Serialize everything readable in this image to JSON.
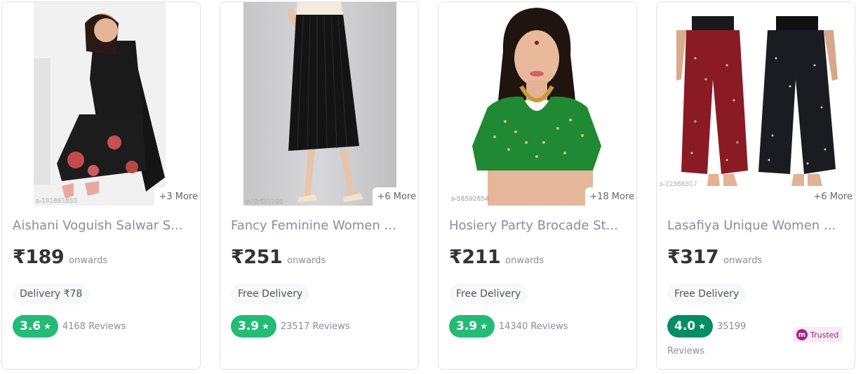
{
  "products": [
    {
      "title": "Aishani Voguish Salwar S...",
      "price": "₹189",
      "onwards": "onwards",
      "delivery": "Delivery ₹78",
      "rating": "3.6",
      "rating_color": "#23bb75",
      "reviews": "4168 Reviews",
      "more": "+3 More",
      "watermark": "s-101891653"
    },
    {
      "title": "Fancy Feminine Women ...",
      "price": "₹251",
      "onwards": "onwards",
      "delivery": "Free Delivery",
      "rating": "3.9",
      "rating_color": "#23bb75",
      "reviews": "23517 Reviews",
      "more": "+6 More",
      "watermark": "s-73622295"
    },
    {
      "title": "Hosiery Party Brocade St...",
      "price": "₹211",
      "onwards": "onwards",
      "delivery": "Free Delivery",
      "rating": "3.9",
      "rating_color": "#23bb75",
      "reviews": "14340 Reviews",
      "more": "+18 More",
      "watermark": "s-56592654"
    },
    {
      "title": "Lasafiya Unique Women ...",
      "price": "₹317",
      "onwards": "onwards",
      "delivery": "Free Delivery",
      "rating": "4.0",
      "rating_color": "#038d63",
      "reviews_count": "35199",
      "reviews_label": "Reviews",
      "more": "+6 More",
      "watermark": "s-12366317",
      "trusted_label": "Trusted"
    }
  ],
  "star_glyph": "★",
  "trusted_logo": "m"
}
